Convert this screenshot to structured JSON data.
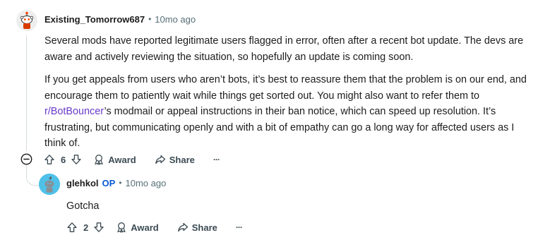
{
  "comment": {
    "author": "Existing_Tomorrow687",
    "separator": "•",
    "time": "10mo ago",
    "paragraph1": "Several mods have reported legitimate users flagged in error, often after a recent bot update. The devs are aware and actively reviewing the situation, so hopefully an update is coming soon.",
    "paragraph2_before_link": "If you get appeals from users who aren’t bots, it’s best to reassure them that the problem is on our end, and encourage them to patiently wait while things get sorted out. You might also want to refer them to ",
    "paragraph2_link": "r/BotBouncer",
    "paragraph2_after_link": "’s modmail or appeal instructions in their ban notice, which can speed up resolution. It’s frustrating, but communicating openly and with a bit of empathy can go a long way for affected users as I think of.",
    "votes": "6",
    "award_label": "Award",
    "share_label": "Share",
    "more_label": "···"
  },
  "reply": {
    "author": "glehkol",
    "op_badge": "OP",
    "separator": "•",
    "time": "10mo ago",
    "body": "Gotcha",
    "votes": "2",
    "award_label": "Award",
    "share_label": "Share",
    "more_label": "···"
  },
  "icons": {
    "collapse": "collapse-minus-icon",
    "upvote": "upvote-arrow-icon",
    "downvote": "downvote-arrow-icon",
    "award": "award-ribbon-icon",
    "share": "share-arrow-icon",
    "more": "more-dots-icon"
  },
  "colors": {
    "link": "#6a3bc9",
    "op_badge": "#0a5ad4",
    "meta_text": "#576f76",
    "reply_avatar_bg": "#4fc1e9"
  }
}
